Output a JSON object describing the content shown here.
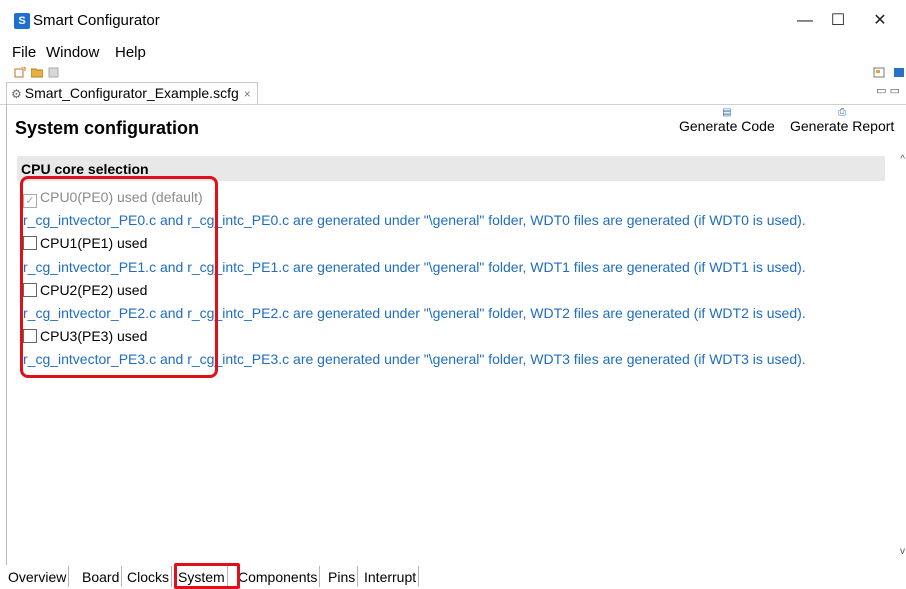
{
  "window": {
    "title": "Smart Configurator",
    "icon": "smart-configurator-logo"
  },
  "window_controls": {
    "minimize": "—",
    "maximize": "☐",
    "close": "✕"
  },
  "menu": [
    "File",
    "Window",
    "Help"
  ],
  "editor_tab": {
    "label": "Smart_Configurator_Example.scfg",
    "close": "×"
  },
  "view_controls": "▭ ▭",
  "page": {
    "title": "System configuration"
  },
  "actions": {
    "generate_code": "Generate Code",
    "generate_report": "Generate Report"
  },
  "section": {
    "title": "CPU core selection"
  },
  "cpus": [
    {
      "label": "CPU0(PE0) used (default)",
      "checked": true,
      "disabled": true,
      "note": "r_cg_intvector_PE0.c and r_cg_intc_PE0.c are generated under \"\\general\" folder, WDT0 files are generated (if WDT0 is used)."
    },
    {
      "label": "CPU1(PE1) used",
      "checked": false,
      "disabled": false,
      "note": "r_cg_intvector_PE1.c and r_cg_intc_PE1.c are generated under \"\\general\" folder, WDT1 files are generated (if WDT1 is used)."
    },
    {
      "label": "CPU2(PE2) used",
      "checked": false,
      "disabled": false,
      "note": "r_cg_intvector_PE2.c and r_cg_intc_PE2.c are generated under \"\\general\" folder, WDT2 files are generated (if WDT2 is used)."
    },
    {
      "label": "CPU3(PE3) used",
      "checked": false,
      "disabled": false,
      "note": "r_cg_intvector_PE3.c and r_cg_intc_PE3.c are generated under \"\\general\" folder, WDT3 files are generated (if WDT3 is used)."
    }
  ],
  "bottom_tabs": [
    "Overview",
    "Board",
    "Clocks",
    "System",
    "Components",
    "Pins",
    "Interrupt"
  ],
  "active_bottom_tab": "System",
  "colors": {
    "link": "#1e6dc2",
    "highlight": "#e0101a",
    "section_bg": "#e8e8e8"
  }
}
